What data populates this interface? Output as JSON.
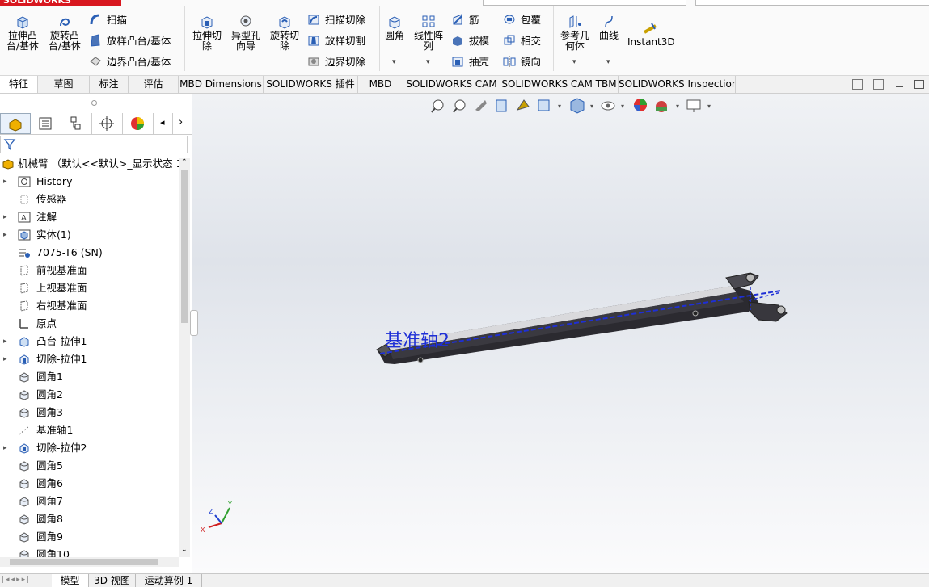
{
  "app": {
    "logo_text": "SOLIDWORKS"
  },
  "ribbon": {
    "extrude_boss": "拉伸凸\n台/基体",
    "revolve_boss": "旋转凸\n台/基体",
    "sweep": "扫描",
    "loft_boss": "放样凸台/基体",
    "boundary_boss": "边界凸台/基体",
    "extrude_cut": "拉伸切\n除",
    "hole_wizard": "异型孔\n向导",
    "revolve_cut": "旋转切\n除",
    "swept_cut": "扫描切除",
    "lofted_cut": "放样切割",
    "boundary_cut": "边界切除",
    "fillet": "圆角",
    "linear_pattern": "线性阵\n列",
    "rib": "筋",
    "draft": "拔模",
    "shell": "抽壳",
    "wrap": "包覆",
    "intersect": "相交",
    "mirror": "镜向",
    "ref_geometry": "参考几\n何体",
    "curves": "曲线",
    "instant3d": "Instant3D"
  },
  "tabs": [
    "特征",
    "草图",
    "标注",
    "评估",
    "MBD Dimensions",
    "SOLIDWORKS 插件",
    "MBD",
    "SOLIDWORKS CAM",
    "SOLIDWORKS CAM TBM",
    "SOLIDWORKS Inspection"
  ],
  "feature_tree": {
    "root": "机械臂 （默认<<默认>_显示状态 1>",
    "items": [
      {
        "label": "History",
        "expand": true,
        "icon": "history-icon"
      },
      {
        "label": "传感器",
        "expand": false,
        "icon": "sensor-icon"
      },
      {
        "label": "注解",
        "expand": true,
        "icon": "annotation-icon"
      },
      {
        "label": "实体(1)",
        "expand": true,
        "icon": "solid-body-icon"
      },
      {
        "label": "7075-T6 (SN)",
        "expand": false,
        "icon": "material-icon"
      },
      {
        "label": "前视基准面",
        "expand": false,
        "icon": "plane-icon"
      },
      {
        "label": "上视基准面",
        "expand": false,
        "icon": "plane-icon"
      },
      {
        "label": "右视基准面",
        "expand": false,
        "icon": "plane-icon"
      },
      {
        "label": "原点",
        "expand": false,
        "icon": "origin-icon"
      },
      {
        "label": "凸台-拉伸1",
        "expand": true,
        "icon": "extrude-icon"
      },
      {
        "label": "切除-拉伸1",
        "expand": true,
        "icon": "cut-icon"
      },
      {
        "label": "圆角1",
        "expand": false,
        "icon": "fillet-icon"
      },
      {
        "label": "圆角2",
        "expand": false,
        "icon": "fillet-icon"
      },
      {
        "label": "圆角3",
        "expand": false,
        "icon": "fillet-icon"
      },
      {
        "label": "基准轴1",
        "expand": false,
        "icon": "axis-icon"
      },
      {
        "label": "切除-拉伸2",
        "expand": true,
        "icon": "cut-icon"
      },
      {
        "label": "圆角5",
        "expand": false,
        "icon": "fillet-icon"
      },
      {
        "label": "圆角6",
        "expand": false,
        "icon": "fillet-icon"
      },
      {
        "label": "圆角7",
        "expand": false,
        "icon": "fillet-icon"
      },
      {
        "label": "圆角8",
        "expand": false,
        "icon": "fillet-icon"
      },
      {
        "label": "圆角9",
        "expand": false,
        "icon": "fillet-icon"
      },
      {
        "label": "圆角10",
        "expand": false,
        "icon": "fillet-icon"
      }
    ]
  },
  "viewport": {
    "axis_label": "基准轴2",
    "triad_x": "X",
    "triad_y": "Y",
    "triad_z": "Z"
  },
  "bottom_tabs": [
    "模型",
    "3D 视图",
    "运动算例 1"
  ],
  "colors": {
    "accent": "#2a5fb5",
    "logo_red": "#d8171f",
    "axis_blue": "#1e2fd6"
  }
}
